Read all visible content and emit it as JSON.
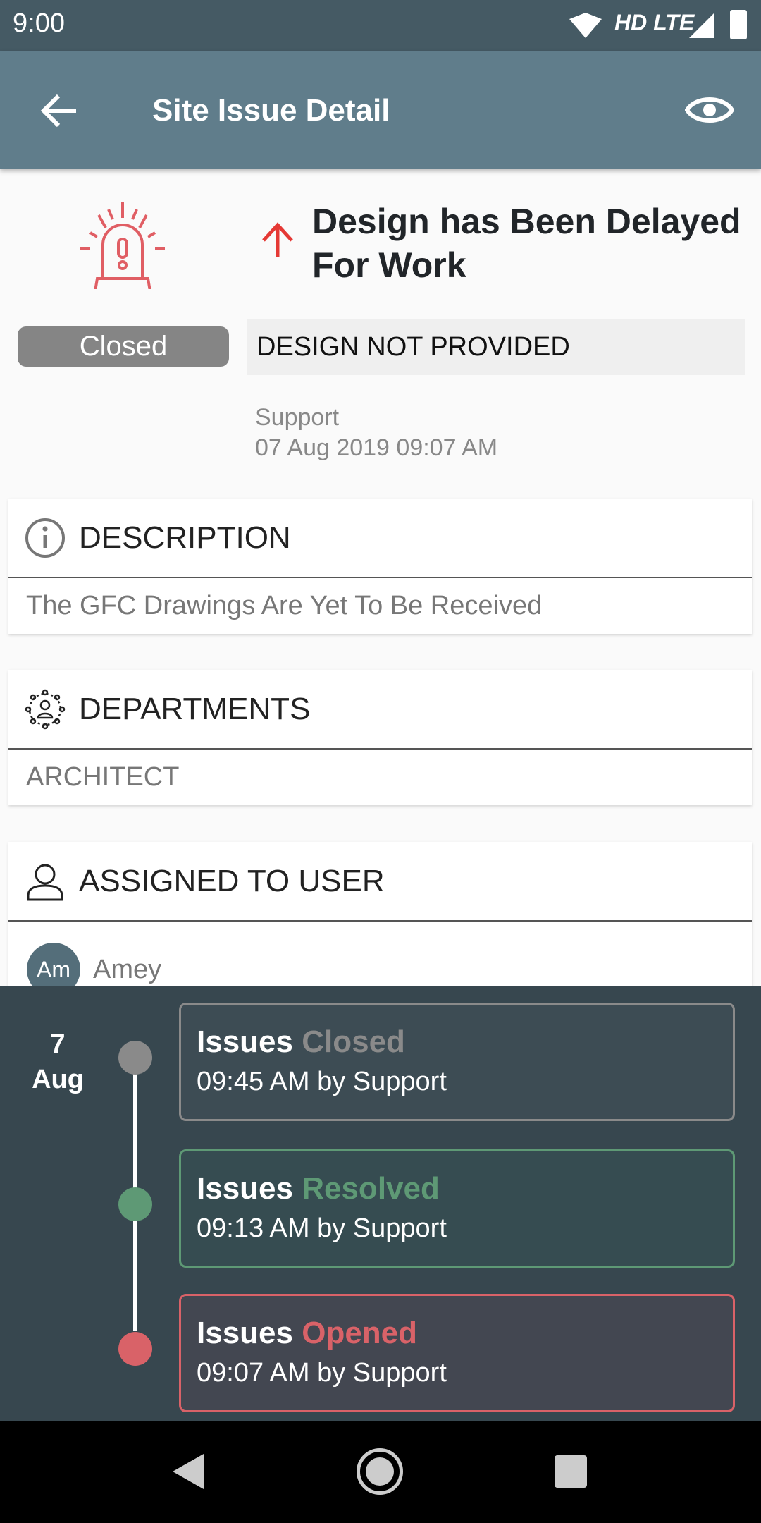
{
  "status_bar": {
    "time": "9:00",
    "network": "HD LTE"
  },
  "app_bar": {
    "title": "Site Issue Detail",
    "back_icon": "arrow-left-icon",
    "watch_icon": "eye-icon"
  },
  "issue": {
    "title": "Design has Been Delayed For Work",
    "priority_icon": "arrow-up-icon",
    "priority_color": "#e53935",
    "status": "Closed",
    "reason": "DESIGN NOT PROVIDED",
    "created_by": "Support",
    "created_at": "07 Aug 2019 09:07 AM"
  },
  "description": {
    "heading": "DESCRIPTION",
    "text": "The GFC Drawings Are Yet To Be Received"
  },
  "departments": {
    "heading": "DEPARTMENTS",
    "text": "ARCHITECT"
  },
  "assigned": {
    "heading": "ASSIGNED TO USER",
    "users": [
      {
        "initials": "Am",
        "name": "Amey"
      }
    ]
  },
  "timeline": {
    "day": "7",
    "month": "Aug",
    "events": [
      {
        "prefix": "Issues",
        "state": "Closed",
        "detail": "09:45 AM by Support",
        "color": "#8a8a8a",
        "bg": "#3d4c54"
      },
      {
        "prefix": "Issues",
        "state": "Resolved",
        "detail": "09:13 AM by Support",
        "color": "#5e9975",
        "bg": "#364c51"
      },
      {
        "prefix": "Issues",
        "state": "Opened",
        "detail": "09:07 AM by Support",
        "color": "#d96268",
        "bg": "#434751"
      }
    ]
  }
}
